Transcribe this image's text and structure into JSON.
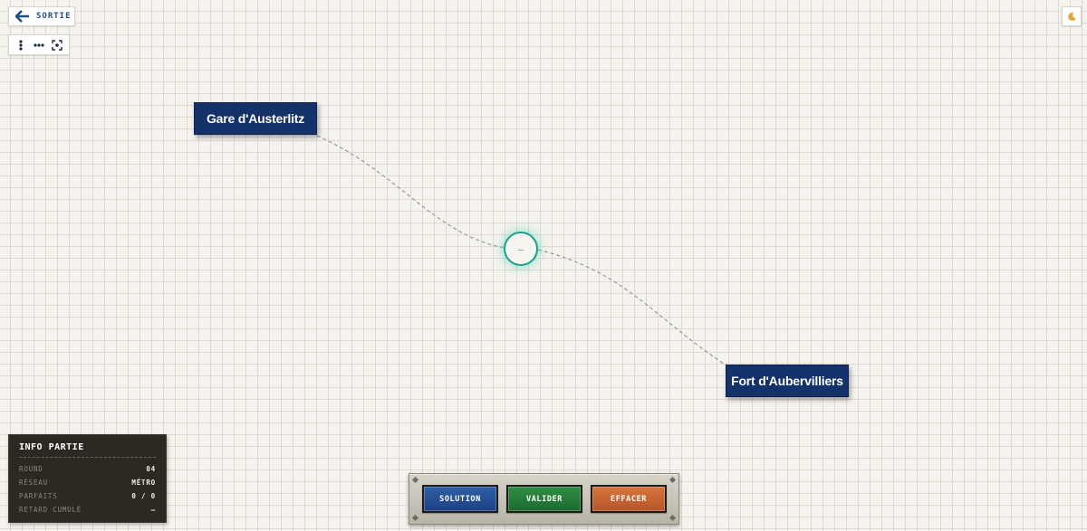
{
  "header": {
    "exit_label": "SORTIE",
    "exit_icon": "arrow-left-icon",
    "theme_icon": "moon-icon",
    "tools": [
      {
        "name": "vertical-layout-icon"
      },
      {
        "name": "horizontal-layout-icon"
      },
      {
        "name": "fit-view-icon"
      }
    ]
  },
  "map": {
    "station_start": "Gare d'Austerlitz",
    "station_end": "Fort d'Aubervilliers",
    "junction_label": "—",
    "colors": {
      "station_bg": "#14326a",
      "junction_ring": "#1fa08a",
      "track": "#9a9a9a"
    }
  },
  "info": {
    "title": "INFO PARTIE",
    "rows": [
      {
        "key": "ROUND",
        "value": "04"
      },
      {
        "key": "RÉSEAU",
        "value": "MÉTRO"
      },
      {
        "key": "PARFAITS",
        "value": "0 / 0"
      },
      {
        "key": "RETARD CUMULÉ",
        "value": "—"
      }
    ]
  },
  "console": {
    "solution": "SOLUTION",
    "valider": "VALIDER",
    "effacer": "EFFACER",
    "colors": {
      "solution": "#1f4a8e",
      "valider": "#237a3a",
      "effacer": "#c96430"
    }
  }
}
